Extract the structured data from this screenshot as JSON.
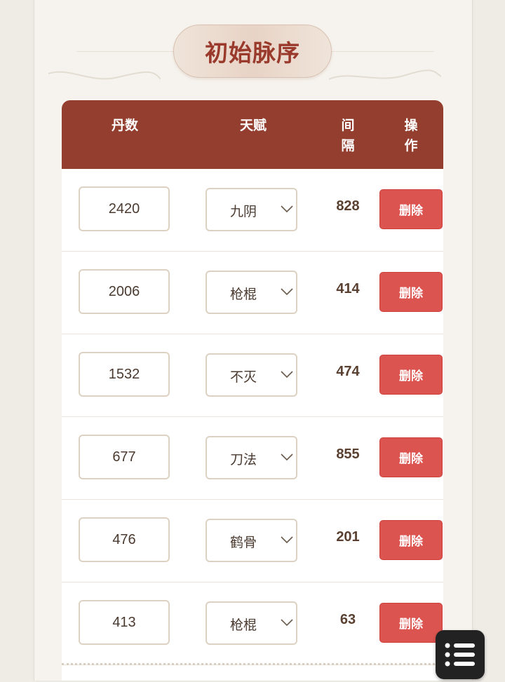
{
  "title": "初始脉序",
  "table": {
    "headers": {
      "count": "丹数",
      "talent": "天赋",
      "interval_line1": "间",
      "interval_line2": "隔",
      "action_line1": "操",
      "action_line2": "作"
    },
    "rows": [
      {
        "count": "2420",
        "talent": "九阴",
        "interval": "828",
        "delete_label": "删除"
      },
      {
        "count": "2006",
        "talent": "枪棍",
        "interval": "414",
        "delete_label": "删除"
      },
      {
        "count": "1532",
        "talent": "不灭",
        "interval": "474",
        "delete_label": "删除"
      },
      {
        "count": "677",
        "talent": "刀法",
        "interval": "855",
        "delete_label": "删除"
      },
      {
        "count": "476",
        "talent": "鹤骨",
        "interval": "201",
        "delete_label": "删除"
      },
      {
        "count": "413",
        "talent": "枪棍",
        "interval": "63",
        "delete_label": "删除"
      }
    ]
  },
  "colors": {
    "header_bg": "#933e2e",
    "title_text": "#9a3a2c",
    "delete_button": "#dc5450",
    "page_bg": "#efece6"
  },
  "icons": {
    "select_arrow": "chevron-down-icon",
    "menu": "list-menu-icon"
  }
}
